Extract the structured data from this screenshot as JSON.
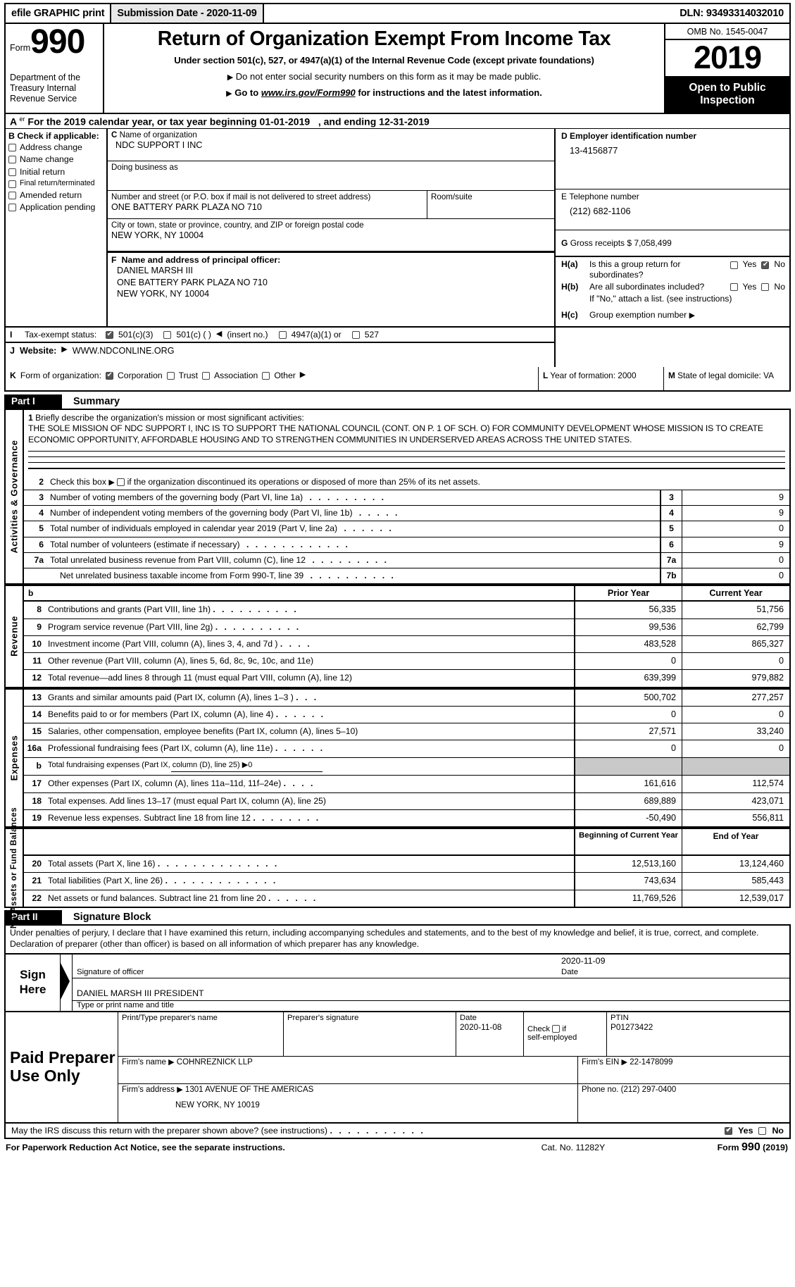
{
  "efile": {
    "graphic_print": "efile GRAPHIC print",
    "submission_date": "Submission Date - 2020-11-09",
    "dln": "DLN: 93493314032010"
  },
  "masthead": {
    "form_label": "Form",
    "form_number": "990",
    "department": "Department of the Treasury Internal Revenue Service",
    "title": "Return of Organization Exempt From Income Tax",
    "subtitle": "Under section 501(c), 527, or 4947(a)(1) of the Internal Revenue Code (except private foundations)",
    "note1": "Do not enter social security numbers on this form as it may be made public.",
    "note2_prefix": "Go to",
    "note2_link": "www.irs.gov/Form990",
    "note2_suffix": "for instructions and the latest information.",
    "omb": "OMB No. 1545-0047",
    "year": "2019",
    "open_to_public": "Open to Public",
    "inspection": "Inspection"
  },
  "line_a": {
    "letter": "A",
    "text_before": "For the 2019 calendar year, or tax year beginning",
    "begin_date": "01-01-2019",
    "text_mid": ", and ending",
    "end_date": "12-31-2019"
  },
  "section_b": {
    "letter": "B",
    "header": "Check if applicable:",
    "items": [
      {
        "label": "Address change",
        "checked": false
      },
      {
        "label": "Name change",
        "checked": false
      },
      {
        "label": "Initial return",
        "checked": false
      },
      {
        "label": "Final return/terminated",
        "checked": false,
        "small": true
      },
      {
        "label": "Amended return",
        "checked": false
      },
      {
        "label": "Application pending",
        "checked": false
      }
    ]
  },
  "section_c": {
    "letter": "C",
    "name_label": "Name of organization",
    "name_value": "NDC SUPPORT I INC",
    "dba_label": "Doing business as",
    "dba_value": "",
    "street_label": "Number and street (or P.O. box if mail is not delivered to street address)",
    "street_value": "ONE BATTERY PARK PLAZA NO 710",
    "room_label": "Room/suite",
    "room_value": "",
    "city_label": "City or town, state or province, country, and ZIP or foreign postal code",
    "city_value": "NEW YORK, NY  10004"
  },
  "section_d": {
    "letter": "D",
    "label": "Employer identification number",
    "value": "13-4156877"
  },
  "section_e": {
    "letter": "E",
    "label": "Telephone number",
    "value": "(212) 682-1106"
  },
  "section_g": {
    "letter": "G",
    "label": "Gross receipts $",
    "value": "7,058,499"
  },
  "section_f": {
    "letter": "F",
    "label": "Name and address of principal officer:",
    "line1": "DANIEL MARSH III",
    "line2": "ONE BATTERY PARK PLAZA NO 710",
    "line3": "NEW YORK, NY  10004"
  },
  "section_h": {
    "ha_tag": "H(a)",
    "ha_text": "Is this a group return for subordinates?",
    "ha_yes": "Yes",
    "ha_no": "No",
    "ha_yes_checked": false,
    "ha_no_checked": true,
    "hb_tag": "H(b)",
    "hb_text": "Are all subordinates included?",
    "hb_yes": "Yes",
    "hb_no": "No",
    "hb_yes_checked": false,
    "hb_no_checked": false,
    "hb_note": "If \"No,\" attach a list. (see instructions)",
    "hc_tag": "H(c)",
    "hc_text": "Group exemption number",
    "hc_value": ""
  },
  "section_i": {
    "letter": "I",
    "label": "Tax-exempt status:",
    "options": [
      {
        "label": "501(c)(3)",
        "checked": true
      },
      {
        "label": "501(c) (  )",
        "checked": false,
        "suffix": "(insert no.)"
      },
      {
        "label": "4947(a)(1) or",
        "checked": false
      },
      {
        "label": "527",
        "checked": false
      }
    ]
  },
  "section_j": {
    "letter": "J",
    "label": "Website:",
    "value": "WWW.NDCONLINE.ORG"
  },
  "section_k": {
    "letter": "K",
    "label": "Form of organization:",
    "options": [
      {
        "label": "Corporation",
        "checked": true
      },
      {
        "label": "Trust",
        "checked": false
      },
      {
        "label": "Association",
        "checked": false
      },
      {
        "label": "Other",
        "checked": false,
        "arrow": true
      }
    ]
  },
  "section_l": {
    "letter": "L",
    "label": "Year of formation:",
    "value": "2000"
  },
  "section_m": {
    "letter": "M",
    "label": "State of legal domicile:",
    "value": "VA"
  },
  "part1": {
    "part_label": "Part I",
    "part_title": "Summary",
    "vertical_label_1": "Activities & Governance",
    "vertical_label_2": "Revenue",
    "vertical_label_3": "Expenses",
    "vertical_label_4": "Net Assets or Fund Balances",
    "line1_num": "1",
    "line1_label": "Briefly describe the organization's mission or most significant activities:",
    "mission": "THE SOLE MISSION OF NDC SUPPORT I, INC IS TO SUPPORT THE NATIONAL COUNCIL (CONT. ON P. 1 OF SCH. O) FOR COMMUNITY DEVELOPMENT WHOSE MISSION IS TO CREATE ECONOMIC OPPORTUNITY, AFFORDABLE HOUSING AND TO STRENGTHEN COMMUNITIES IN UNDERSERVED AREAS ACROSS THE UNITED STATES.",
    "line2_num": "2",
    "line2_text_a": "Check this box",
    "line2_text_b": "if the organization discontinued its operations or disposed of more than 25% of its net assets.",
    "line2_checked": false,
    "gov_rows": [
      {
        "num": "3",
        "desc": "Number of voting members of the governing body (Part VI, line 1a)",
        "dots": ". . . . . . . . .",
        "code": "3",
        "value": "9"
      },
      {
        "num": "4",
        "desc": "Number of independent voting members of the governing body (Part VI, line 1b)",
        "dots": ". . . . .",
        "code": "4",
        "value": "9"
      },
      {
        "num": "5",
        "desc": "Total number of individuals employed in calendar year 2019 (Part V, line 2a)",
        "dots": ". . . . . .",
        "code": "5",
        "value": "0"
      },
      {
        "num": "6",
        "desc": "Total number of volunteers (estimate if necessary)",
        "dots": ". . . . . . . . . . . .",
        "code": "6",
        "value": "9"
      },
      {
        "num": "7a",
        "desc": "Total unrelated business revenue from Part VIII, column (C), line 12",
        "dots": ". . . . . . . . .",
        "code": "7a",
        "value": "0"
      },
      {
        "num": "",
        "desc": "Net unrelated business taxable income from Form 990-T, line 39",
        "dots": ". . . . . . . . . .",
        "code": "7b",
        "value": "0"
      }
    ],
    "col_prior": "Prior Year",
    "col_current": "Current Year",
    "b_marker": "b",
    "revenue_rows": [
      {
        "num": "8",
        "desc": "Contributions and grants (Part VIII, line 1h)",
        "dots": ". . . . . . . . . .",
        "prior": "56,335",
        "current": "51,756"
      },
      {
        "num": "9",
        "desc": "Program service revenue (Part VIII, line 2g)",
        "dots": ". . . . . . . . . .",
        "prior": "99,536",
        "current": "62,799"
      },
      {
        "num": "10",
        "desc": "Investment income (Part VIII, column (A), lines 3, 4, and 7d )",
        "dots": ". . . .",
        "prior": "483,528",
        "current": "865,327"
      },
      {
        "num": "11",
        "desc": "Other revenue (Part VIII, column (A), lines 5, 6d, 8c, 9c, 10c, and 11e)",
        "dots": "",
        "prior": "0",
        "current": "0"
      },
      {
        "num": "12",
        "desc": "Total revenue—add lines 8 through 11 (must equal Part VIII, column (A), line 12)",
        "dots": "",
        "prior": "639,399",
        "current": "979,882"
      }
    ],
    "expense_rows": [
      {
        "num": "13",
        "desc": "Grants and similar amounts paid (Part IX, column (A), lines 1–3 )",
        "dots": ". . .",
        "prior": "500,702",
        "current": "277,257"
      },
      {
        "num": "14",
        "desc": "Benefits paid to or for members (Part IX, column (A), line 4)",
        "dots": ". . . . . .",
        "prior": "0",
        "current": "0"
      },
      {
        "num": "15",
        "desc": "Salaries, other compensation, employee benefits (Part IX, column (A), lines 5–10)",
        "dots": "",
        "prior": "27,571",
        "current": "33,240"
      },
      {
        "num": "16a",
        "desc": "Professional fundraising fees (Part IX, column (A), line 11e)",
        "dots": ". . . . . .",
        "prior": "0",
        "current": "0"
      },
      {
        "num": "b",
        "desc": "Total fundraising expenses (Part IX, column (D), line 25)",
        "dots": "",
        "prior": "",
        "current": "",
        "shaded": true,
        "inline_value": "0",
        "small": true
      },
      {
        "num": "17",
        "desc": "Other expenses (Part IX, column (A), lines 11a–11d, 11f–24e)",
        "dots": ". . . .",
        "prior": "161,616",
        "current": "112,574"
      },
      {
        "num": "18",
        "desc": "Total expenses. Add lines 13–17 (must equal Part IX, column (A), line 25)",
        "dots": "",
        "prior": "689,889",
        "current": "423,071"
      },
      {
        "num": "19",
        "desc": "Revenue less expenses. Subtract line 18 from line 12",
        "dots": ". . . . . . . .",
        "prior": "-50,490",
        "current": "556,811"
      }
    ],
    "col_begin": "Beginning of Current Year",
    "col_end": "End of Year",
    "asset_rows": [
      {
        "num": "20",
        "desc": "Total assets (Part X, line 16)",
        "dots": ". . . . . . . . . . . . . .",
        "prior": "12,513,160",
        "current": "13,124,460"
      },
      {
        "num": "21",
        "desc": "Total liabilities (Part X, line 26)",
        "dots": ". . . . . . . . . . . . .",
        "prior": "743,634",
        "current": "585,443"
      },
      {
        "num": "22",
        "desc": "Net assets or fund balances. Subtract line 21 from line 20",
        "dots": ". . . . . .",
        "prior": "11,769,526",
        "current": "12,539,017"
      }
    ]
  },
  "part2": {
    "part_label": "Part II",
    "part_title": "Signature Block",
    "perjury": "Under penalties of perjury, I declare that I have examined this return, including accompanying schedules and statements, and to the best of my knowledge and belief, it is true, correct, and complete. Declaration of preparer (other than officer) is based on all information of which preparer has any knowledge.",
    "sign_here": "Sign Here",
    "sig_officer_value": "",
    "sig_officer_caption": "Signature of officer",
    "date_value": "2020-11-09",
    "date_caption": "Date",
    "name_title_value": "DANIEL MARSH III  PRESIDENT",
    "name_title_caption": "Type or print name and title"
  },
  "preparer": {
    "title": "Paid Preparer Use Only",
    "name_caption": "Print/Type preparer's name",
    "name_value": "",
    "sig_caption": "Preparer's signature",
    "sig_value": "",
    "date_caption": "Date",
    "date_value": "2020-11-08",
    "check_caption_a": "Check",
    "check_caption_b": "if",
    "check_caption_c": "self-employed",
    "self_employed_checked": false,
    "ptin_caption": "PTIN",
    "ptin_value": "P01273422",
    "firm_name_caption": "Firm's name",
    "firm_name_value": "COHNREZNICK LLP",
    "firm_ein_caption": "Firm's EIN",
    "firm_ein_value": "22-1478099",
    "firm_addr_caption": "Firm's address",
    "firm_addr_value": "1301 AVENUE OF THE AMERICAS",
    "firm_addr_value2": "NEW YORK, NY  10019",
    "phone_caption": "Phone no.",
    "phone_value": "(212) 297-0400"
  },
  "footer": {
    "irs_question": "May the IRS discuss this return with the preparer shown above? (see instructions)",
    "irs_dots": ". . . . . . . . . . .",
    "yes": "Yes",
    "no": "No",
    "yes_checked": true,
    "no_checked": false,
    "paperwork": "For Paperwork Reduction Act Notice, see the separate instructions.",
    "cat_no": "Cat. No. 11282Y",
    "form_ref_a": "Form",
    "form_ref_b": "990",
    "form_ref_c": "(2019)"
  }
}
